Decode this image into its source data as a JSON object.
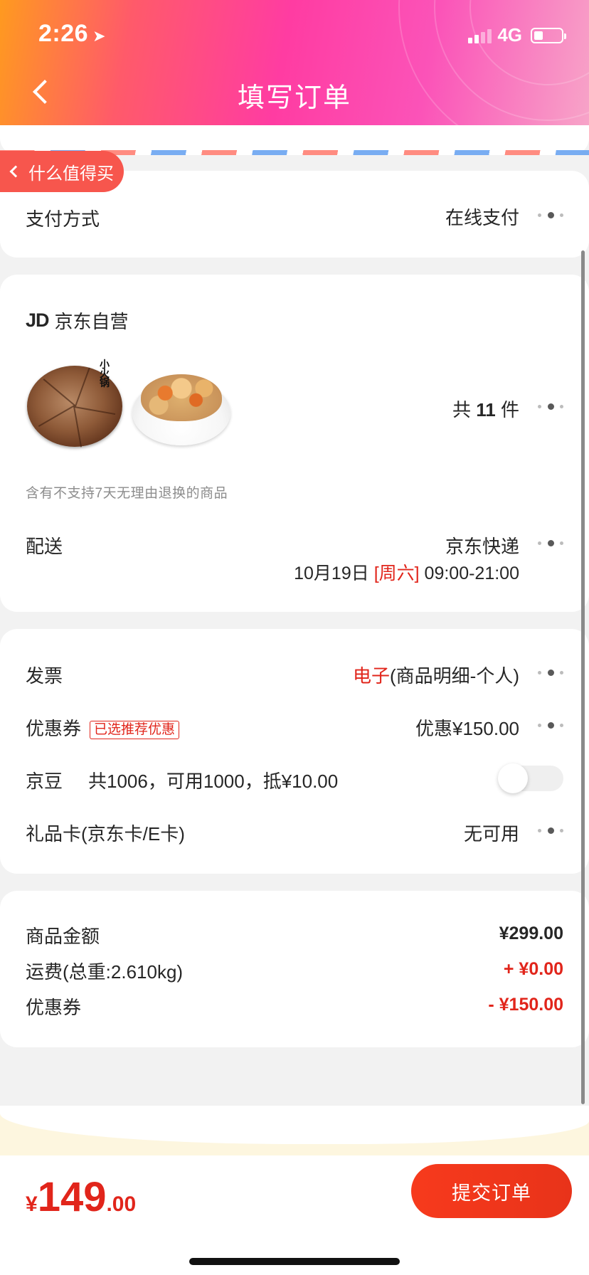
{
  "status_bar": {
    "time": "2:26",
    "network": "4G"
  },
  "header": {
    "title": "填写订单"
  },
  "float_tag": {
    "label": "什么值得买"
  },
  "payment": {
    "label": "支付方式",
    "value": "在线支付"
  },
  "shop": {
    "logo": "JD",
    "name": "京东自营",
    "product_count_prefix": "共",
    "product_count": "11",
    "product_count_suffix": "件",
    "return_notice": "含有不支持7天无理由退换的商品"
  },
  "delivery": {
    "label": "配送",
    "carrier": "京东快递",
    "date": "10月19日",
    "weekday": "[周六]",
    "time_range": "09:00-21:00"
  },
  "invoice": {
    "label": "发票",
    "type": "电子",
    "detail": "(商品明细-个人)"
  },
  "coupon": {
    "label": "优惠券",
    "tag": "已选推荐优惠",
    "value": "优惠¥150.00"
  },
  "jd_bean": {
    "label": "京豆",
    "detail": "共1006，可用1000，抵¥10.00",
    "enabled": false
  },
  "gift_card": {
    "label": "礼品卡(京东卡/E卡)",
    "value": "无可用"
  },
  "summary": {
    "goods_label": "商品金额",
    "goods_value": "¥299.00",
    "freight_label": "运费(总重:2.610kg)",
    "freight_value": "+ ¥0.00",
    "coupon_label": "优惠券",
    "coupon_value": "- ¥150.00"
  },
  "footer": {
    "currency": "¥",
    "total_int": "149",
    "total_dec": ".00",
    "submit_label": "提交订单"
  },
  "colors": {
    "accent_red": "#e1251b",
    "button_red": "#f73a1c",
    "header_gradient_start": "#ff9a1f",
    "header_gradient_end": "#f7a4c8"
  }
}
